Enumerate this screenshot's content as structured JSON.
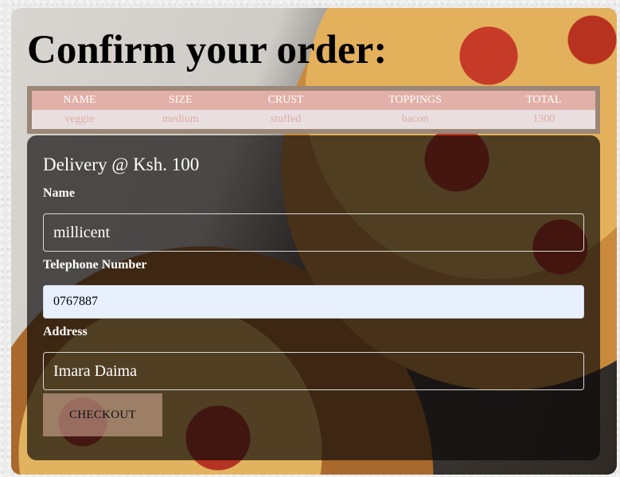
{
  "page": {
    "title": "Confirm your order:"
  },
  "order_table": {
    "headers": [
      "NAME",
      "SIZE",
      "CRUST",
      "TOPPINGS",
      "TOTAL"
    ],
    "row": [
      "veggie",
      "medium",
      "stuffed",
      "bacon",
      "1300"
    ]
  },
  "delivery_form": {
    "heading": "Delivery @ Ksh. 100",
    "name_label": "Name",
    "name_value": "millicent",
    "phone_label": "Telephone Number",
    "phone_value": "0767887",
    "address_label": "Address",
    "address_value": "Imara Daima",
    "checkout_label": "CHECKOUT"
  },
  "colors": {
    "table_header_bg": "#e2b0a8",
    "table_border": "#9c8777",
    "autofill_input_bg": "#e8f0fe",
    "panel_bg": "#0a0807"
  }
}
